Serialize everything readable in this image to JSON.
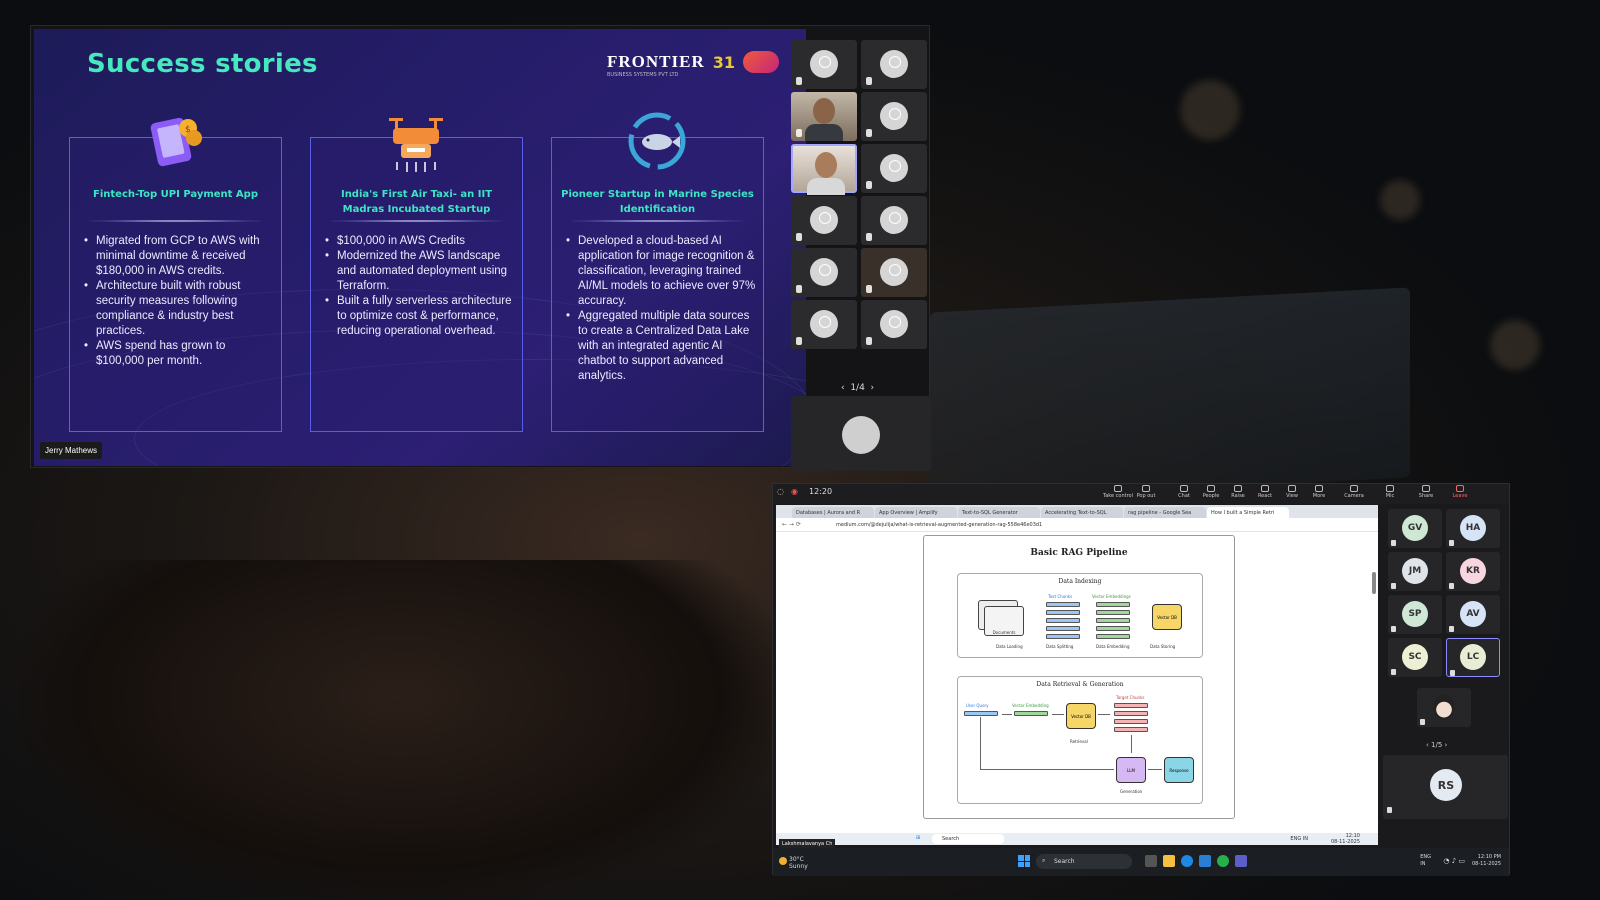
{
  "slide": {
    "title": "Success stories",
    "logo": {
      "name": "FRONTIER",
      "tagline": "BUSINESS SYSTEMS PVT LTD",
      "badge": "31"
    },
    "cards": [
      {
        "heading": "Fintech-Top UPI Payment App",
        "icon": "payment-phone-icon",
        "bullets": [
          "Migrated from GCP to AWS with minimal downtime & received $180,000 in AWS credits.",
          "Architecture built with robust security measures following compliance & industry best practices.",
          "AWS spend has grown to $100,000 per month."
        ]
      },
      {
        "heading": "India's First Air Taxi- an IIT Madras Incubated Startup",
        "icon": "drone-icon",
        "bullets": [
          "$100,000 in AWS Credits",
          "Modernized the AWS landscape and automated deployment using Terraform.",
          "Built a fully serverless architecture to optimize cost & performance, reducing operational overhead."
        ]
      },
      {
        "heading": "Pioneer Startup in Marine Species Identification",
        "icon": "fish-icon",
        "bullets": [
          "Developed a cloud-based AI application for image recognition & classification, leveraging trained AI/ML models to achieve over 97% accuracy.",
          "Aggregated multiple data sources to create a Centralized Data Lake with an integrated agentic AI chatbot to support advanced analytics."
        ]
      }
    ],
    "presenter": "Jerry Mathews"
  },
  "gallery1": {
    "pager": "1/4"
  },
  "window2": {
    "clock": "12:20",
    "toolbar": [
      "Take control",
      "Pop out",
      "Chat",
      "People",
      "Raise",
      "React",
      "View",
      "More",
      "Camera",
      "Mic",
      "Share",
      "Leave"
    ],
    "browser": {
      "tabs": [
        "Databases | Aurora and R",
        "App Overview | Amplify",
        "Text-to-SQL Generator",
        "Accelerating Text-to-SQL",
        "rag pipeline - Google Sea",
        "How I built a Simple Retri"
      ],
      "url": "medium.com/@dejulija/what-is-retrieval-augmented-generation-rag-558e46e03d1"
    },
    "diagram": {
      "title": "Basic RAG Pipeline",
      "indexing": {
        "title": "Data Indexing",
        "labels": [
          "Documents",
          "Text Chunks",
          "Vector Embeddings",
          "Vector DB",
          "Data Loading",
          "Data Splitting",
          "Data Embedding",
          "Data Storing"
        ]
      },
      "retrieval": {
        "title": "Data Retrieval & Generation",
        "labels": [
          "User Query",
          "Vector Embedding",
          "Vector DB",
          "Target Chunks",
          "Retrieval",
          "LLM",
          "Response",
          "Generation"
        ]
      }
    },
    "inner_taskbar": {
      "search": "Search",
      "lang": "ENG IN",
      "time": "12:10",
      "date": "08-11-2025"
    },
    "caption": "Lakshmalavanya Ch",
    "participants": [
      "GV",
      "HA",
      "JM",
      "KR",
      "SP",
      "AV",
      "SC",
      "LC"
    ],
    "pager": "1/5",
    "self_initials": "RS"
  },
  "host_taskbar": {
    "weather_temp": "30°C",
    "weather_text": "Sunny",
    "search": "Search",
    "lang1": "ENG",
    "lang2": "IN",
    "time": "12:10 PM",
    "date": "08-11-2025"
  },
  "colors": {
    "accent": "#46e8c0",
    "slide_bg": "#261d6a",
    "card_border": "#5a5ee6"
  }
}
